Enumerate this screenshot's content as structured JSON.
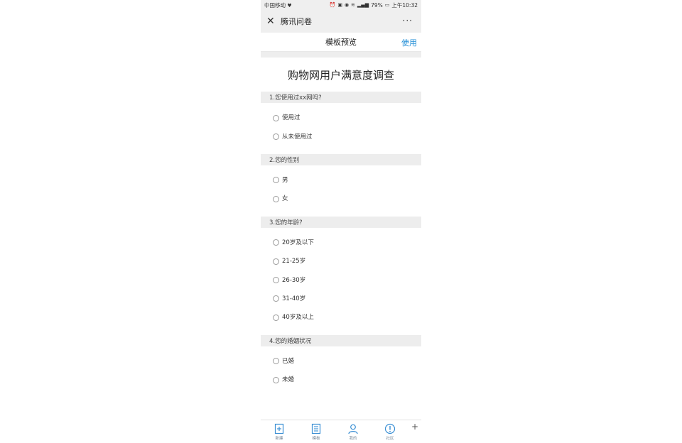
{
  "status": {
    "carrier": "中国移动",
    "battery": "79%",
    "time": "上午10:32"
  },
  "header": {
    "title": "腾讯问卷",
    "more": "···"
  },
  "preview": {
    "title": "模板预览",
    "use_label": "使用"
  },
  "survey": {
    "title": "购物网用户满意度调查",
    "questions": [
      {
        "label": "1.您使用过xx网吗?",
        "options": [
          "使用过",
          "从未使用过"
        ]
      },
      {
        "label": "2.您的性别",
        "options": [
          "男",
          "女"
        ]
      },
      {
        "label": "3.您的年龄?",
        "options": [
          "20岁及以下",
          "21-25岁",
          "26-30岁",
          "31-40岁",
          "40岁及以上"
        ]
      },
      {
        "label": "4.您的婚姻状况",
        "options": [
          "已婚",
          "未婚"
        ]
      }
    ]
  },
  "bottom_nav": {
    "items": [
      {
        "label": "新建",
        "icon": "new-doc-icon"
      },
      {
        "label": "模板",
        "icon": "template-icon"
      },
      {
        "label": "我的",
        "icon": "user-icon"
      },
      {
        "label": "社区",
        "icon": "info-icon"
      }
    ],
    "plus": "+"
  },
  "colors": {
    "accent": "#1f8dd6",
    "nav_icon": "#3a8fd4"
  }
}
